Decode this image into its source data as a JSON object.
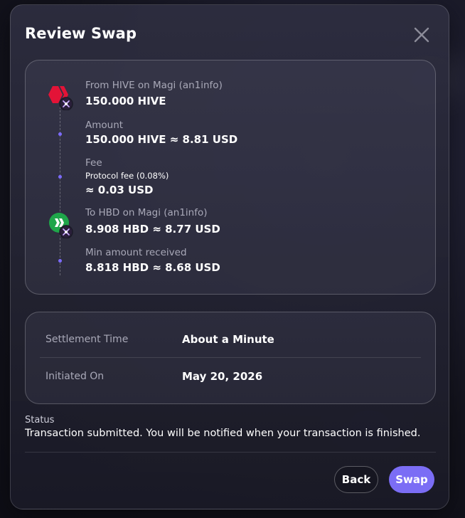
{
  "modal": {
    "title": "Review Swap"
  },
  "route": {
    "from": {
      "label": "From HIVE on Magi (an1info)",
      "value": "150.000 HIVE",
      "icon": "hive-coin-icon"
    },
    "amount": {
      "label": "Amount",
      "value": "150.000 HIVE ≈ 8.81 USD"
    },
    "fee": {
      "label": "Fee",
      "detail": "Protocol fee (0.08%)",
      "value": "≈ 0.03 USD"
    },
    "to": {
      "label": "To HBD on Magi (an1info)",
      "value": "8.908 HBD ≈ 8.77 USD",
      "icon": "hbd-coin-icon"
    },
    "min_received": {
      "label": "Min amount received",
      "value": "8.818 HBD ≈ 8.68 USD"
    }
  },
  "details": {
    "settlement_label": "Settlement Time",
    "settlement_value": "About a Minute",
    "initiated_label": "Initiated On",
    "initiated_value": "May 20, 2026"
  },
  "status": {
    "label": "Status",
    "text": "Transaction submitted. You will be notified when your transaction is finished."
  },
  "actions": {
    "back_label": "Back",
    "swap_label": "Swap"
  },
  "colors": {
    "accent": "#7b6df5",
    "hive_red": "#e31337",
    "hbd_green": "#1fa64a"
  }
}
